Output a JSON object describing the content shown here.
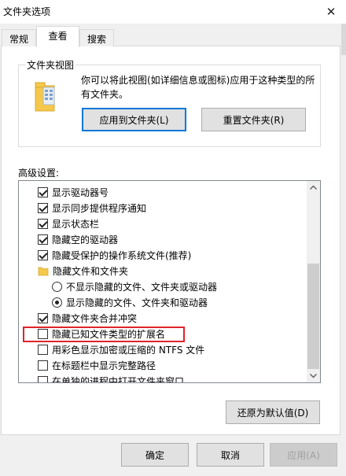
{
  "window": {
    "title": "文件夹选项",
    "close_glyph": "✕"
  },
  "tabs": [
    {
      "label": "常规"
    },
    {
      "label": "查看"
    },
    {
      "label": "搜索"
    }
  ],
  "folder_view": {
    "legend": "文件夹视图",
    "description": "你可以将此视图(如详细信息或图标)应用于这种类型的所有文件夹。",
    "apply_button": "应用到文件夹(L)",
    "reset_button": "重置文件夹(R)"
  },
  "advanced": {
    "label": "高级设置:",
    "items": [
      {
        "kind": "checkbox",
        "checked": true,
        "label": "显示驱动器号"
      },
      {
        "kind": "checkbox",
        "checked": true,
        "label": "显示同步提供程序通知"
      },
      {
        "kind": "checkbox",
        "checked": true,
        "label": "显示状态栏"
      },
      {
        "kind": "checkbox",
        "checked": true,
        "label": "隐藏空的驱动器"
      },
      {
        "kind": "checkbox",
        "checked": true,
        "label": "隐藏受保护的操作系统文件(推荐)"
      },
      {
        "kind": "folder",
        "label": "隐藏文件和文件夹"
      },
      {
        "kind": "radio",
        "checked": false,
        "label": "不显示隐藏的文件、文件夹或驱动器"
      },
      {
        "kind": "radio",
        "checked": true,
        "label": "显示隐藏的文件、文件夹和驱动器"
      },
      {
        "kind": "checkbox",
        "checked": true,
        "label": "隐藏文件夹合并冲突"
      },
      {
        "kind": "checkbox",
        "checked": false,
        "label": "隐藏已知文件类型的扩展名"
      },
      {
        "kind": "checkbox",
        "checked": false,
        "label": "用彩色显示加密或压缩的 NTFS 文件"
      },
      {
        "kind": "checkbox",
        "checked": false,
        "label": "在标题栏中显示完整路径"
      },
      {
        "kind": "checkbox",
        "checked": false,
        "label": "在单独的进程中打开文件夹窗口"
      }
    ],
    "restore_button": "还原为默认值(D)"
  },
  "footer": {
    "ok": "确定",
    "cancel": "取消",
    "apply": "应用(A)"
  },
  "colors": {
    "highlight": "#e0242a",
    "focus": "#0078d7",
    "folder": "#f5c84c"
  }
}
